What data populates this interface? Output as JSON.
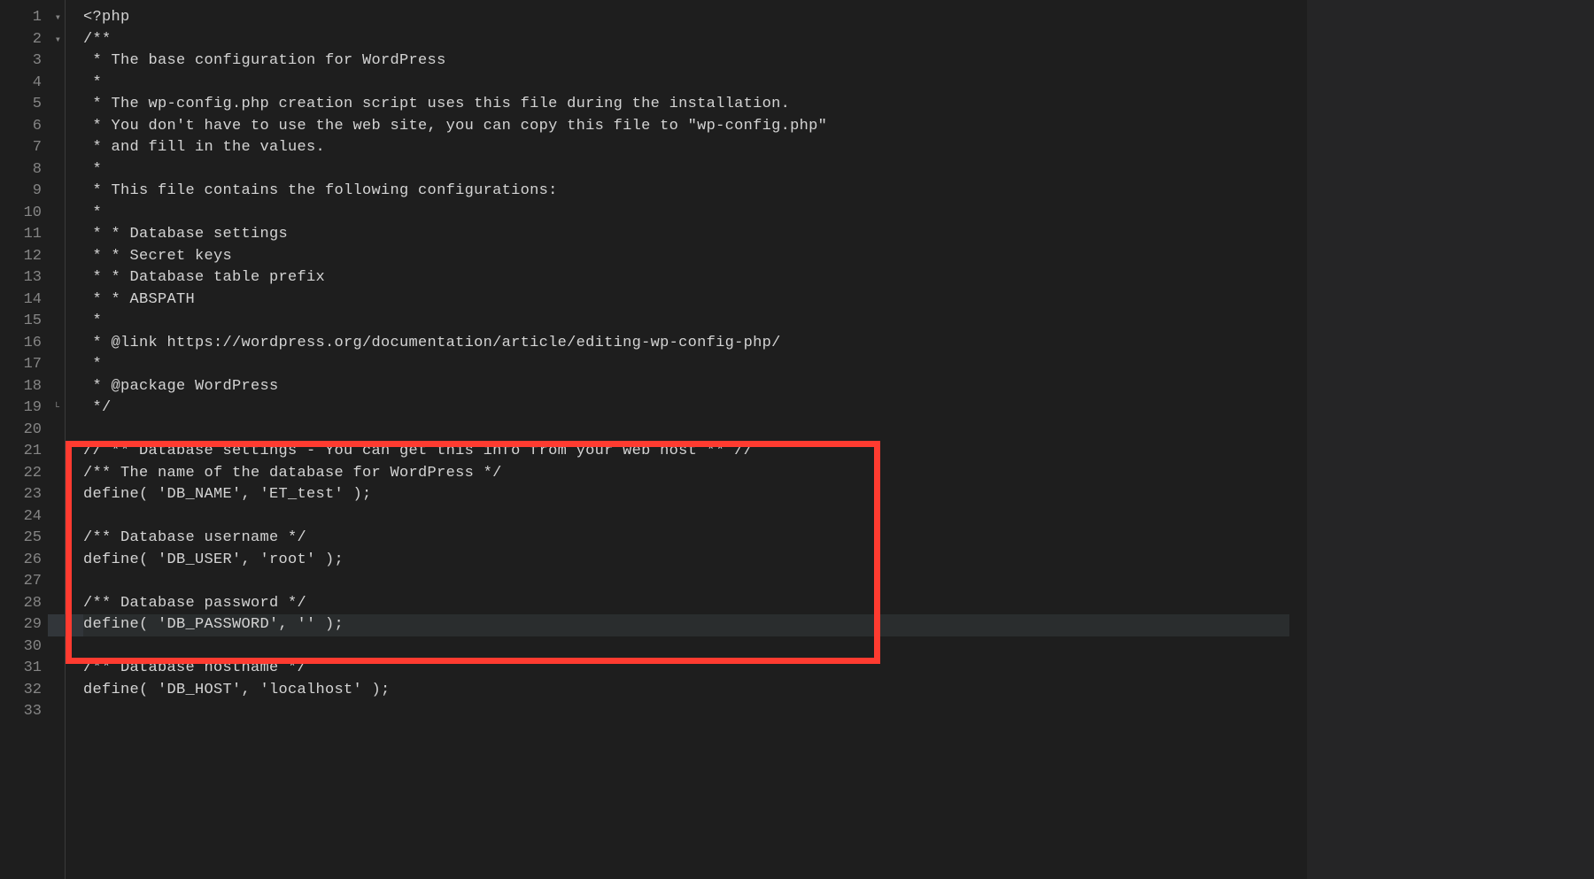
{
  "editor": {
    "lines": [
      {
        "num": 1,
        "fold": "down",
        "text": "<?php"
      },
      {
        "num": 2,
        "fold": "down",
        "text": "/**"
      },
      {
        "num": 3,
        "text": " * The base configuration for WordPress"
      },
      {
        "num": 4,
        "text": " *"
      },
      {
        "num": 5,
        "text": " * The wp-config.php creation script uses this file during the installation."
      },
      {
        "num": 6,
        "text": " * You don't have to use the web site, you can copy this file to \"wp-config.php\""
      },
      {
        "num": 7,
        "text": " * and fill in the values."
      },
      {
        "num": 8,
        "text": " *"
      },
      {
        "num": 9,
        "text": " * This file contains the following configurations:"
      },
      {
        "num": 10,
        "text": " *"
      },
      {
        "num": 11,
        "text": " * * Database settings"
      },
      {
        "num": 12,
        "text": " * * Secret keys"
      },
      {
        "num": 13,
        "text": " * * Database table prefix"
      },
      {
        "num": 14,
        "text": " * * ABSPATH"
      },
      {
        "num": 15,
        "text": " *"
      },
      {
        "num": 16,
        "text": " * @link https://wordpress.org/documentation/article/editing-wp-config-php/"
      },
      {
        "num": 17,
        "text": " *"
      },
      {
        "num": 18,
        "text": " * @package WordPress"
      },
      {
        "num": 19,
        "fold": "end",
        "text": " */"
      },
      {
        "num": 20,
        "text": ""
      },
      {
        "num": 21,
        "text": "// ** Database settings - You can get this info from your web host ** //"
      },
      {
        "num": 22,
        "text": "/** The name of the database for WordPress */"
      },
      {
        "num": 23,
        "text": "define( 'DB_NAME', 'ET_test' );"
      },
      {
        "num": 24,
        "text": ""
      },
      {
        "num": 25,
        "text": "/** Database username */"
      },
      {
        "num": 26,
        "text": "define( 'DB_USER', 'root' );"
      },
      {
        "num": 27,
        "text": ""
      },
      {
        "num": 28,
        "text": "/** Database password */"
      },
      {
        "num": 29,
        "highlighted": true,
        "text": "define( 'DB_PASSWORD', '' );"
      },
      {
        "num": 30,
        "text": ""
      },
      {
        "num": 31,
        "text": "/** Database hostname */"
      },
      {
        "num": 32,
        "text": "define( 'DB_HOST', 'localhost' );"
      },
      {
        "num": 33,
        "text": ""
      }
    ]
  }
}
